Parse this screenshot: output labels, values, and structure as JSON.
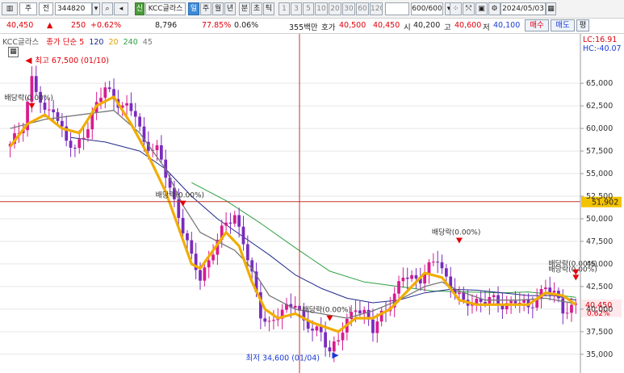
{
  "toolbar": {
    "main_type": "주",
    "market": "전",
    "code": "344820",
    "change_pct": "+0.62%",
    "badge": "신",
    "stock_name": "KCC글라스",
    "periods": [
      "일",
      "주",
      "월",
      "년",
      "분",
      "초",
      "틱"
    ],
    "selected_period": "일",
    "intervals": [
      "1",
      "3",
      "5",
      "10",
      "20",
      "30",
      "60",
      "120"
    ],
    "count": "600/600",
    "date": "2024/05/03"
  },
  "quote": {
    "price": "40,450",
    "arrow": "▲",
    "change": "250",
    "change_pct": "+0.62%",
    "volume": "8,796",
    "ratio": "77.85%",
    "turnover": "0.06%",
    "amount": "355백만",
    "ask_label": "호가",
    "ask": "40,500",
    "bid": "40,450",
    "open_label": "시",
    "open": "40,200",
    "high_label": "고",
    "high": "40,600",
    "low_label": "저",
    "low": "40,100",
    "buy_label": "매수",
    "sell_label": "매도",
    "eval_label": "평"
  },
  "legend": {
    "name": "KCC글라스",
    "type": "종가 단순",
    "ma5": "5",
    "ma120": "120",
    "ma20": "20",
    "ma240": "240",
    "ma45": "45"
  },
  "corner": {
    "lc": "LC:16.91",
    "hc": "HC:-40.07"
  },
  "colors": {
    "up": "#e0000b",
    "down": "#1a3bd6",
    "candle": "#d81b8f",
    "ma5": "#222222",
    "ma20": "#f0ad00",
    "ma45": "#777777",
    "ma120": "#1e2a8a",
    "ma240": "#2ea043",
    "cross": "#c0392b"
  },
  "chart_data": {
    "type": "candlestick",
    "y_axis_ticks": [
      "65,000",
      "62,500",
      "60,000",
      "57,500",
      "55,000",
      "52,500",
      "50,000",
      "47,500",
      "45,000",
      "42,500",
      "40,000",
      "37,500",
      "35,000"
    ],
    "ylim": [
      34000,
      68500
    ],
    "n_candles": 132,
    "close_path": [
      [
        0,
        58000
      ],
      [
        3,
        60500
      ],
      [
        5,
        65500
      ],
      [
        8,
        61500
      ],
      [
        10,
        62500
      ],
      [
        13,
        58500
      ],
      [
        15,
        57500
      ],
      [
        18,
        60500
      ],
      [
        22,
        64500
      ],
      [
        26,
        62500
      ],
      [
        29,
        61500
      ],
      [
        31,
        58500
      ],
      [
        34,
        57500
      ],
      [
        37,
        53500
      ],
      [
        39,
        50500
      ],
      [
        42,
        45500
      ],
      [
        44,
        43500
      ],
      [
        47,
        46500
      ],
      [
        50,
        49500
      ],
      [
        52,
        50500
      ],
      [
        54,
        47500
      ],
      [
        56,
        43500
      ],
      [
        58,
        39500
      ],
      [
        60,
        38500
      ],
      [
        63,
        39500
      ],
      [
        66,
        41000
      ],
      [
        68,
        38500
      ],
      [
        70,
        37500
      ],
      [
        72,
        37500
      ],
      [
        74,
        35500
      ],
      [
        76,
        36500
      ],
      [
        78,
        38500
      ],
      [
        80,
        40500
      ],
      [
        82,
        39500
      ],
      [
        84,
        37500
      ],
      [
        86,
        39500
      ],
      [
        89,
        41500
      ],
      [
        91,
        43500
      ],
      [
        93,
        43500
      ],
      [
        95,
        43500
      ],
      [
        97,
        44500
      ],
      [
        99,
        45500
      ],
      [
        101,
        43500
      ],
      [
        103,
        42000
      ],
      [
        105,
        40500
      ],
      [
        108,
        41000
      ],
      [
        111,
        41000
      ],
      [
        114,
        40500
      ],
      [
        117,
        41000
      ],
      [
        120,
        40000
      ],
      [
        122,
        41500
      ],
      [
        124,
        42500
      ],
      [
        126,
        41500
      ],
      [
        128,
        40000
      ],
      [
        131,
        40450
      ]
    ],
    "ma20_path": [
      [
        0,
        58000
      ],
      [
        4,
        60500
      ],
      [
        8,
        61500
      ],
      [
        12,
        60000
      ],
      [
        16,
        59500
      ],
      [
        20,
        62500
      ],
      [
        24,
        63500
      ],
      [
        28,
        60500
      ],
      [
        32,
        57000
      ],
      [
        36,
        53000
      ],
      [
        39,
        49000
      ],
      [
        42,
        45000
      ],
      [
        44,
        44500
      ],
      [
        47,
        46500
      ],
      [
        50,
        48500
      ],
      [
        53,
        47000
      ],
      [
        56,
        43000
      ],
      [
        59,
        40000
      ],
      [
        62,
        39000
      ],
      [
        66,
        39500
      ],
      [
        70,
        38500
      ],
      [
        73,
        38000
      ],
      [
        76,
        37500
      ],
      [
        80,
        39000
      ],
      [
        84,
        39000
      ],
      [
        88,
        40000
      ],
      [
        92,
        42000
      ],
      [
        96,
        44000
      ],
      [
        100,
        43500
      ],
      [
        104,
        41000
      ],
      [
        108,
        40500
      ],
      [
        112,
        40500
      ],
      [
        116,
        40500
      ],
      [
        120,
        40500
      ],
      [
        124,
        41800
      ],
      [
        128,
        41500
      ],
      [
        131,
        40500
      ]
    ],
    "ma45_path": [
      [
        0,
        60000
      ],
      [
        8,
        61000
      ],
      [
        16,
        61500
      ],
      [
        24,
        62000
      ],
      [
        30,
        59500
      ],
      [
        36,
        55500
      ],
      [
        40,
        51500
      ],
      [
        44,
        48500
      ],
      [
        48,
        47500
      ],
      [
        52,
        46500
      ],
      [
        56,
        44500
      ],
      [
        60,
        41500
      ],
      [
        66,
        40000
      ],
      [
        72,
        39500
      ],
      [
        78,
        39000
      ],
      [
        84,
        39800
      ],
      [
        90,
        41000
      ],
      [
        96,
        42500
      ],
      [
        100,
        43000
      ],
      [
        104,
        42000
      ],
      [
        110,
        41000
      ],
      [
        118,
        41000
      ],
      [
        124,
        41200
      ],
      [
        131,
        40600
      ]
    ],
    "ma120_path": [
      [
        14,
        59000
      ],
      [
        22,
        58500
      ],
      [
        30,
        57500
      ],
      [
        36,
        55500
      ],
      [
        42,
        52500
      ],
      [
        48,
        50000
      ],
      [
        54,
        48000
      ],
      [
        60,
        46000
      ],
      [
        66,
        43800
      ],
      [
        72,
        42300
      ],
      [
        78,
        41200
      ],
      [
        84,
        40700
      ],
      [
        90,
        41000
      ],
      [
        96,
        41800
      ],
      [
        102,
        42200
      ],
      [
        108,
        42100
      ],
      [
        114,
        41800
      ],
      [
        120,
        41500
      ],
      [
        126,
        41500
      ],
      [
        131,
        41000
      ]
    ],
    "ma240_path": [
      [
        42,
        54000
      ],
      [
        50,
        52000
      ],
      [
        58,
        49500
      ],
      [
        66,
        46800
      ],
      [
        74,
        44200
      ],
      [
        82,
        43000
      ],
      [
        90,
        42500
      ],
      [
        98,
        42000
      ],
      [
        106,
        41900
      ],
      [
        114,
        41800
      ],
      [
        120,
        41900
      ],
      [
        126,
        41600
      ],
      [
        131,
        41300
      ]
    ],
    "hline": {
      "value": 51902,
      "label": "51,902"
    },
    "vline": {
      "index": 67
    },
    "current": {
      "value": 40450,
      "label": "40,450",
      "pct": "0.62%"
    },
    "annotations": [
      {
        "text": "최고 67,500 (01/10)",
        "x": 5,
        "y": 67500,
        "type": "high"
      },
      {
        "text": "최저 34,600 (01/04)",
        "x": 74,
        "y": 34600,
        "type": "low"
      },
      {
        "text": "배당락(0.00%)",
        "x": 5,
        "y": 62800,
        "type": "dividend"
      },
      {
        "text": "배당락(0.00%)",
        "x": 40,
        "y": 52000,
        "type": "dividend"
      },
      {
        "text": "배당락(0.00%)",
        "x": 74,
        "y": 39300,
        "type": "dividend"
      },
      {
        "text": "배당락(0.00%)",
        "x": 104,
        "y": 47900,
        "type": "dividend"
      },
      {
        "text": "배당락(0.00%)",
        "x": 138,
        "y": 43800,
        "type": "dividend"
      },
      {
        "text": "배당락(0.00%)",
        "x": 148,
        "y": 44400,
        "type": "dividend"
      }
    ]
  }
}
